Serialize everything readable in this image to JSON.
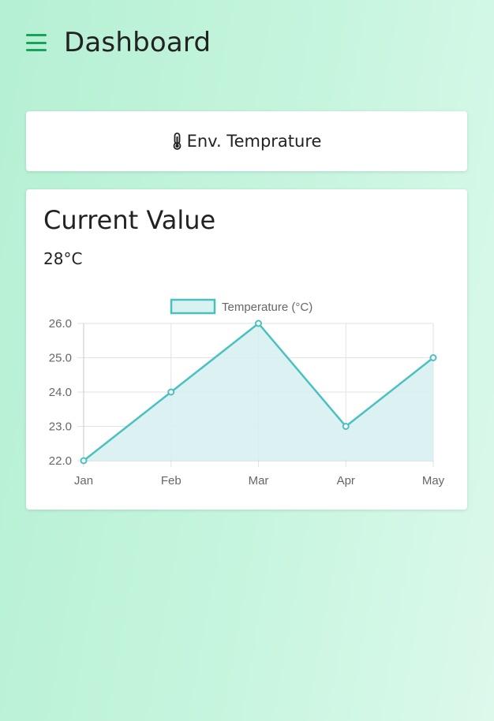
{
  "header": {
    "title": "Dashboard",
    "menu_icon": "hamburger-menu-icon"
  },
  "sensor_card": {
    "icon": "thermometer-icon",
    "label": "Env. Temprature"
  },
  "value_card": {
    "heading": "Current Value",
    "value": "28°C"
  },
  "colors": {
    "accent": "#16a35a",
    "line": "#4bc0c0",
    "fill": "#d8f1f1"
  },
  "chart_data": {
    "type": "line",
    "categories": [
      "Jan",
      "Feb",
      "Mar",
      "Apr",
      "May"
    ],
    "series": [
      {
        "name": "Temperature (°C)",
        "values": [
          22.0,
          24.0,
          26.0,
          23.0,
          25.0
        ]
      }
    ],
    "ylim": [
      22.0,
      26.0
    ],
    "yticks": [
      "22.0",
      "23.0",
      "24.0",
      "25.0",
      "26.0"
    ],
    "fill": true,
    "grid": true,
    "legend": "top"
  }
}
